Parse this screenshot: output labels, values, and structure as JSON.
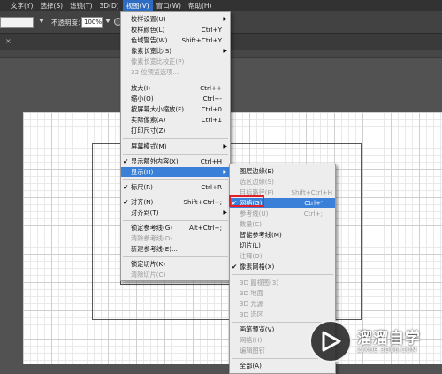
{
  "menubar": {
    "items": [
      "文字(Y)",
      "选择(S)",
      "滤镜(T)",
      "3D(D)",
      "视图(V)",
      "窗口(W)",
      "帮助(H)"
    ],
    "active_index": 4
  },
  "options": {
    "opacity_label": "不透明度：",
    "opacity_value": "100%"
  },
  "view_menu": {
    "items": [
      {
        "label": "校样设置(U)",
        "shortcut": "",
        "submenu": true,
        "disabled": false
      },
      {
        "label": "校样颜色(L)",
        "shortcut": "Ctrl+Y",
        "submenu": false,
        "disabled": false
      },
      {
        "label": "色域警告(W)",
        "shortcut": "Shift+Ctrl+Y",
        "submenu": false,
        "disabled": false
      },
      {
        "label": "像素长宽比(S)",
        "shortcut": "",
        "submenu": true,
        "disabled": false
      },
      {
        "label": "像素长宽比校正(P)",
        "shortcut": "",
        "submenu": false,
        "disabled": true
      },
      {
        "label": "32 位预览选项...",
        "shortcut": "",
        "submenu": false,
        "disabled": true
      },
      {
        "label": "放大(I)",
        "shortcut": "Ctrl++",
        "submenu": false,
        "disabled": false
      },
      {
        "label": "缩小(O)",
        "shortcut": "Ctrl+-",
        "submenu": false,
        "disabled": false
      },
      {
        "label": "按屏幕大小缩放(F)",
        "shortcut": "Ctrl+0",
        "submenu": false,
        "disabled": false
      },
      {
        "label": "实际像素(A)",
        "shortcut": "Ctrl+1",
        "submenu": false,
        "disabled": false
      },
      {
        "label": "打印尺寸(Z)",
        "shortcut": "",
        "submenu": false,
        "disabled": false
      },
      {
        "label": "屏幕模式(M)",
        "shortcut": "",
        "submenu": true,
        "disabled": false
      },
      {
        "label": "显示额外内容(X)",
        "shortcut": "Ctrl+H",
        "submenu": false,
        "disabled": false,
        "checked": true
      },
      {
        "label": "显示(H)",
        "shortcut": "",
        "submenu": true,
        "disabled": false,
        "highlighted": true
      },
      {
        "label": "标尺(R)",
        "shortcut": "Ctrl+R",
        "submenu": false,
        "disabled": false,
        "checked": true
      },
      {
        "label": "对齐(N)",
        "shortcut": "Shift+Ctrl+;",
        "submenu": false,
        "disabled": false,
        "checked": true
      },
      {
        "label": "对齐到(T)",
        "shortcut": "",
        "submenu": true,
        "disabled": false
      },
      {
        "label": "锁定参考线(G)",
        "shortcut": "Alt+Ctrl+;",
        "submenu": false,
        "disabled": false
      },
      {
        "label": "清除参考线(D)",
        "shortcut": "",
        "submenu": false,
        "disabled": true
      },
      {
        "label": "新建参考线(E)...",
        "shortcut": "",
        "submenu": false,
        "disabled": false
      },
      {
        "label": "锁定切片(K)",
        "shortcut": "",
        "submenu": false,
        "disabled": false
      },
      {
        "label": "清除切片(C)",
        "shortcut": "",
        "submenu": false,
        "disabled": true
      }
    ]
  },
  "show_submenu": {
    "items": [
      {
        "label": "图层边缘(E)",
        "shortcut": "",
        "disabled": false
      },
      {
        "label": "选区边缘(S)",
        "shortcut": "",
        "disabled": true
      },
      {
        "label": "目标路径(P)",
        "shortcut": "Shift+Ctrl+H",
        "disabled": true
      },
      {
        "label": "网格(G)",
        "shortcut": "Ctrl+'",
        "disabled": false,
        "checked": true,
        "highlighted": true
      },
      {
        "label": "参考线(U)",
        "shortcut": "Ctrl+;",
        "disabled": true
      },
      {
        "label": "数量(C)",
        "shortcut": "",
        "disabled": true
      },
      {
        "label": "智能参考线(M)",
        "shortcut": "",
        "disabled": false
      },
      {
        "label": "切片(L)",
        "shortcut": "",
        "disabled": false
      },
      {
        "label": "注释(O)",
        "shortcut": "",
        "disabled": true
      },
      {
        "label": "像素网格(X)",
        "shortcut": "",
        "disabled": false,
        "checked": true
      },
      {
        "label": "3D 副视图(3)",
        "shortcut": "",
        "disabled": true
      },
      {
        "label": "3D 地面",
        "shortcut": "",
        "disabled": true
      },
      {
        "label": "3D 光源",
        "shortcut": "",
        "disabled": true
      },
      {
        "label": "3D 选区",
        "shortcut": "",
        "disabled": true
      },
      {
        "label": "画笔预览(V)",
        "shortcut": "",
        "disabled": false
      },
      {
        "label": "网格(H)",
        "shortcut": "",
        "disabled": true
      },
      {
        "label": "编辑图钉",
        "shortcut": "",
        "disabled": true
      },
      {
        "label": "全部(A)",
        "shortcut": "",
        "disabled": false
      }
    ]
  },
  "watermark": {
    "title": "溜溜自学",
    "subtitle": "ZIXUE.3D66.COM"
  }
}
